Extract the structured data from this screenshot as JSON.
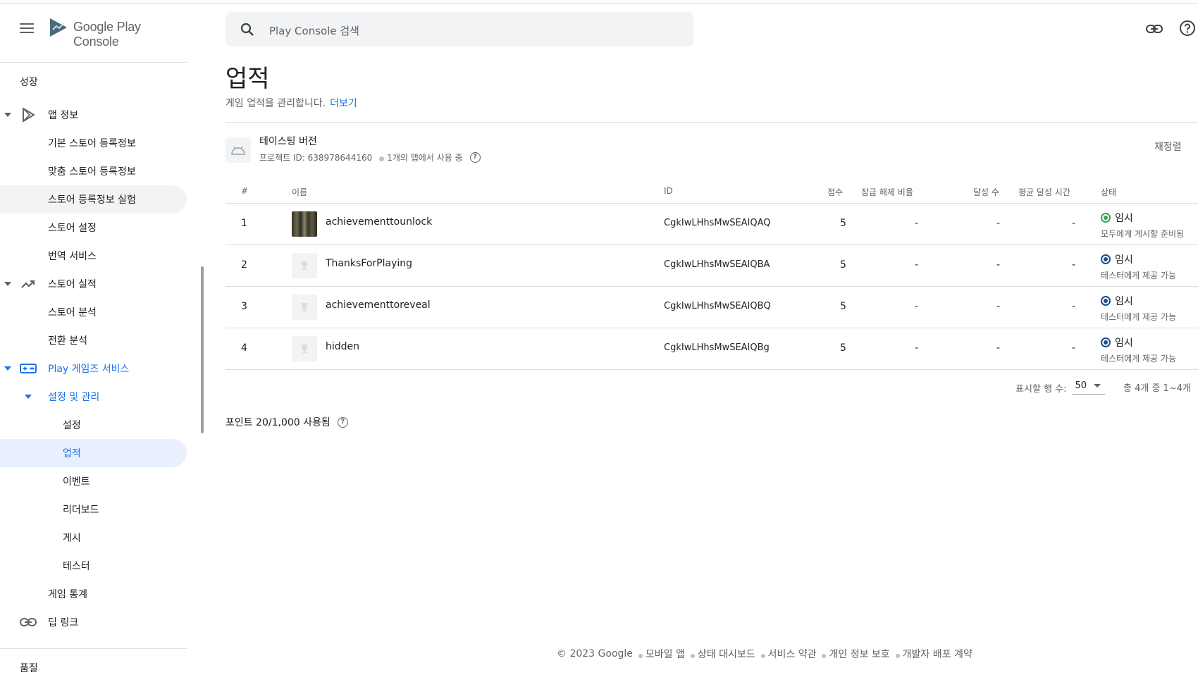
{
  "brand": {
    "name": "Google Play Console"
  },
  "search": {
    "placeholder": "Play Console 검색"
  },
  "sidebar": {
    "section": "성장",
    "items": [
      {
        "label": "앱 정보"
      },
      {
        "label": "기본 스토어 등록정보"
      },
      {
        "label": "맞춤 스토어 등록정보"
      },
      {
        "label": "스토어 등록정보 실험"
      },
      {
        "label": "스토어 설정"
      },
      {
        "label": "번역 서비스"
      },
      {
        "label": "스토어 실적"
      },
      {
        "label": "스토어 분석"
      },
      {
        "label": "전환 분석"
      },
      {
        "label": "Play 게임즈 서비스"
      },
      {
        "label": "설정 및 관리"
      },
      {
        "label": "설정"
      },
      {
        "label": "업적"
      },
      {
        "label": "이벤트"
      },
      {
        "label": "리더보드"
      },
      {
        "label": "게시"
      },
      {
        "label": "테스터"
      },
      {
        "label": "게임 통계"
      },
      {
        "label": "딥 링크"
      }
    ],
    "bottom_section": "품질"
  },
  "page": {
    "title": "업적",
    "subtitle": "게임 업적을 관리합니다.",
    "learn_more": "더보기"
  },
  "project": {
    "name": "테이스팅 버전",
    "id_text": "프로젝트 ID: 638978644160",
    "usage": "1개의 앱에서 사용 중",
    "reorder": "재정렬"
  },
  "table": {
    "headers": [
      "#",
      "이름",
      "ID",
      "점수",
      "잠금 해제 비율",
      "달성 수",
      "평균 달성 시간",
      "상태"
    ],
    "rows": [
      {
        "num": "1",
        "name": "achievementtounlock",
        "id": "CgkIwLHhsMwSEAIQAQ",
        "points": "5",
        "unlock": "-",
        "count": "-",
        "avg": "-",
        "status": "임시",
        "status_sub": "모두에게 게시할 준비됨",
        "status_color": "#34a853"
      },
      {
        "num": "2",
        "name": "ThanksForPlaying",
        "id": "CgkIwLHhsMwSEAIQBA",
        "points": "5",
        "unlock": "-",
        "count": "-",
        "avg": "-",
        "status": "임시",
        "status_sub": "테스터에게 제공 가능",
        "status_color": "#1a73e8"
      },
      {
        "num": "3",
        "name": "achievementtoreveal",
        "id": "CgkIwLHhsMwSEAIQBQ",
        "points": "5",
        "unlock": "-",
        "count": "-",
        "avg": "-",
        "status": "임시",
        "status_sub": "테스터에게 제공 가능",
        "status_color": "#1a73e8"
      },
      {
        "num": "4",
        "name": "hidden",
        "id": "CgkIwLHhsMwSEAIQBg",
        "points": "5",
        "unlock": "-",
        "count": "-",
        "avg": "-",
        "status": "임시",
        "status_sub": "테스터에게 제공 가능",
        "status_color": "#1a73e8"
      }
    ]
  },
  "pager": {
    "rows_label": "표시할 행 수:",
    "rows_value": "50",
    "range": "총 4개 중 1~4개"
  },
  "points_used": "포인트 20/1,000 사용됨",
  "footer": [
    "© 2023 Google",
    "모바일 앱",
    "상태 대시보드",
    "서비스 약관",
    "개인 정보 보호",
    "개발자 배포 계약"
  ]
}
